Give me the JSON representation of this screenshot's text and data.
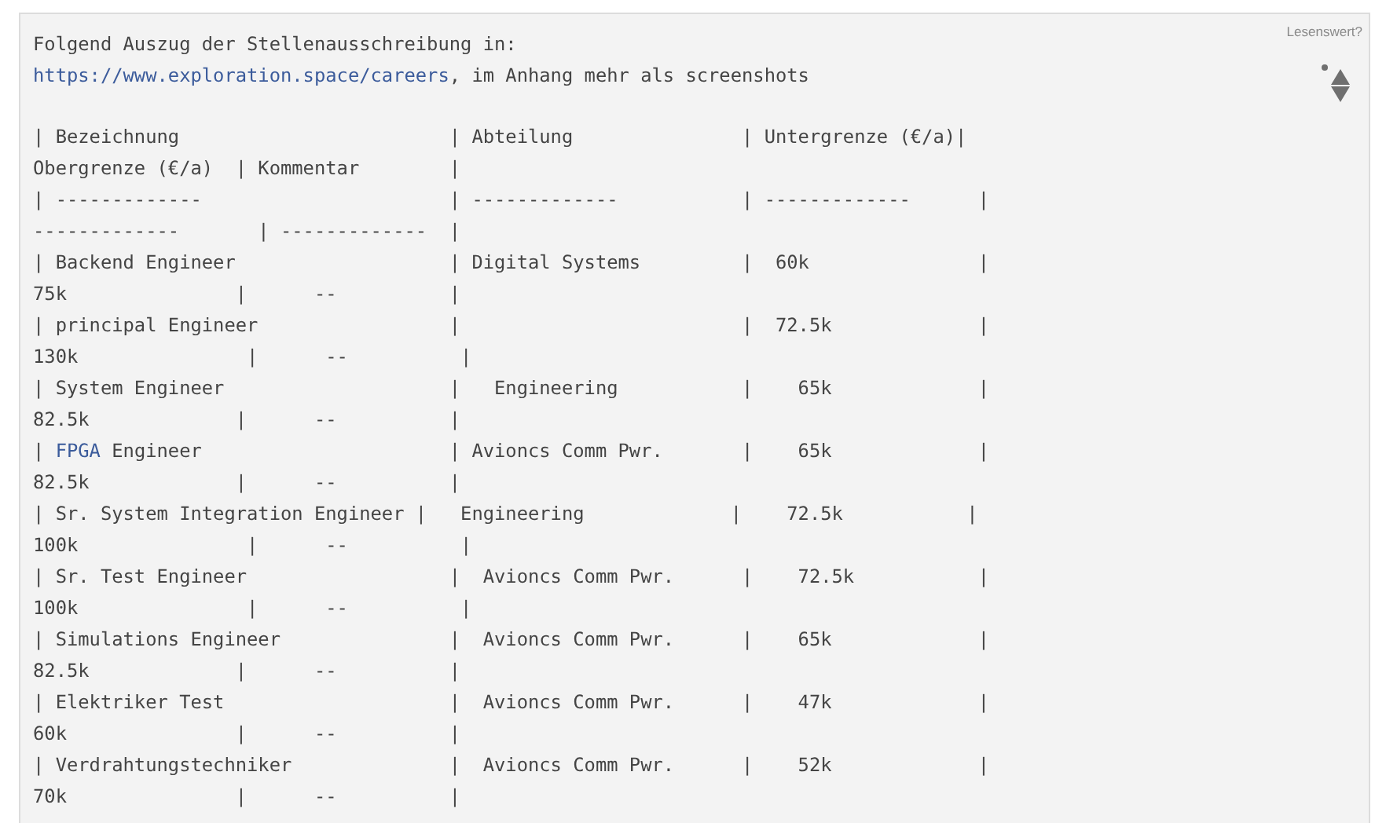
{
  "post": {
    "intro": [
      {
        "segments": [
          {
            "kind": "text",
            "text": "Folgend Auszug der Stellenausschreibung in:"
          }
        ]
      },
      {
        "segments": [
          {
            "kind": "link",
            "text": "https://www.exploration.space/careers"
          },
          {
            "kind": "text",
            "text": ", im Anhang mehr als screenshots"
          }
        ]
      }
    ],
    "table_lines": [
      {
        "segments": [
          {
            "kind": "text",
            "text": "| Bezeichnung                        | Abteilung               | Untergrenze (€/a)|"
          }
        ]
      },
      {
        "segments": [
          {
            "kind": "text",
            "text": "Obergrenze (€/a)  | Kommentar        |"
          }
        ]
      },
      {
        "segments": [
          {
            "kind": "text",
            "text": "| -------------                      | -------------           | -------------      |"
          }
        ]
      },
      {
        "segments": [
          {
            "kind": "text",
            "text": "-------------       | -------------  |"
          }
        ]
      },
      {
        "segments": [
          {
            "kind": "text",
            "text": "| Backend Engineer                   | Digital Systems         |  60k               |"
          }
        ]
      },
      {
        "segments": [
          {
            "kind": "text",
            "text": "75k               |      --          |"
          }
        ]
      },
      {
        "segments": [
          {
            "kind": "text",
            "text": "| principal Engineer                 |                         |  72.5k             |"
          }
        ]
      },
      {
        "segments": [
          {
            "kind": "text",
            "text": "130k               |      --          |"
          }
        ]
      },
      {
        "segments": [
          {
            "kind": "text",
            "text": "| System Engineer                    |   Engineering           |    65k             |"
          }
        ]
      },
      {
        "segments": [
          {
            "kind": "text",
            "text": "82.5k             |      --          |"
          }
        ]
      },
      {
        "segments": [
          {
            "kind": "text",
            "text": "| "
          },
          {
            "kind": "link",
            "text": "FPGA"
          },
          {
            "kind": "text",
            "text": " Engineer                      | Avioncs Comm Pwr.       |    65k             |"
          }
        ]
      },
      {
        "segments": [
          {
            "kind": "text",
            "text": "82.5k             |      --          |"
          }
        ]
      },
      {
        "segments": [
          {
            "kind": "text",
            "text": "| Sr. System Integration Engineer |   Engineering             |    72.5k           |"
          }
        ]
      },
      {
        "segments": [
          {
            "kind": "text",
            "text": "100k               |      --          |"
          }
        ]
      },
      {
        "segments": [
          {
            "kind": "text",
            "text": "| Sr. Test Engineer                  |  Avioncs Comm Pwr.      |    72.5k           |"
          }
        ]
      },
      {
        "segments": [
          {
            "kind": "text",
            "text": "100k               |      --          |"
          }
        ]
      },
      {
        "segments": [
          {
            "kind": "text",
            "text": "| Simulations Engineer               |  Avioncs Comm Pwr.      |    65k             |"
          }
        ]
      },
      {
        "segments": [
          {
            "kind": "text",
            "text": "82.5k             |      --          |"
          }
        ]
      },
      {
        "segments": [
          {
            "kind": "text",
            "text": "| Elektriker Test                    |  Avioncs Comm Pwr.      |    47k             |"
          }
        ]
      },
      {
        "segments": [
          {
            "kind": "text",
            "text": "60k               |      --          |"
          }
        ]
      },
      {
        "segments": [
          {
            "kind": "text",
            "text": "| Verdrahtungstechniker              |  Avioncs Comm Pwr.      |    52k             |"
          }
        ]
      },
      {
        "segments": [
          {
            "kind": "text",
            "text": "70k               |      --          |"
          }
        ]
      }
    ],
    "vote": {
      "label": "Lesenswert?"
    }
  }
}
